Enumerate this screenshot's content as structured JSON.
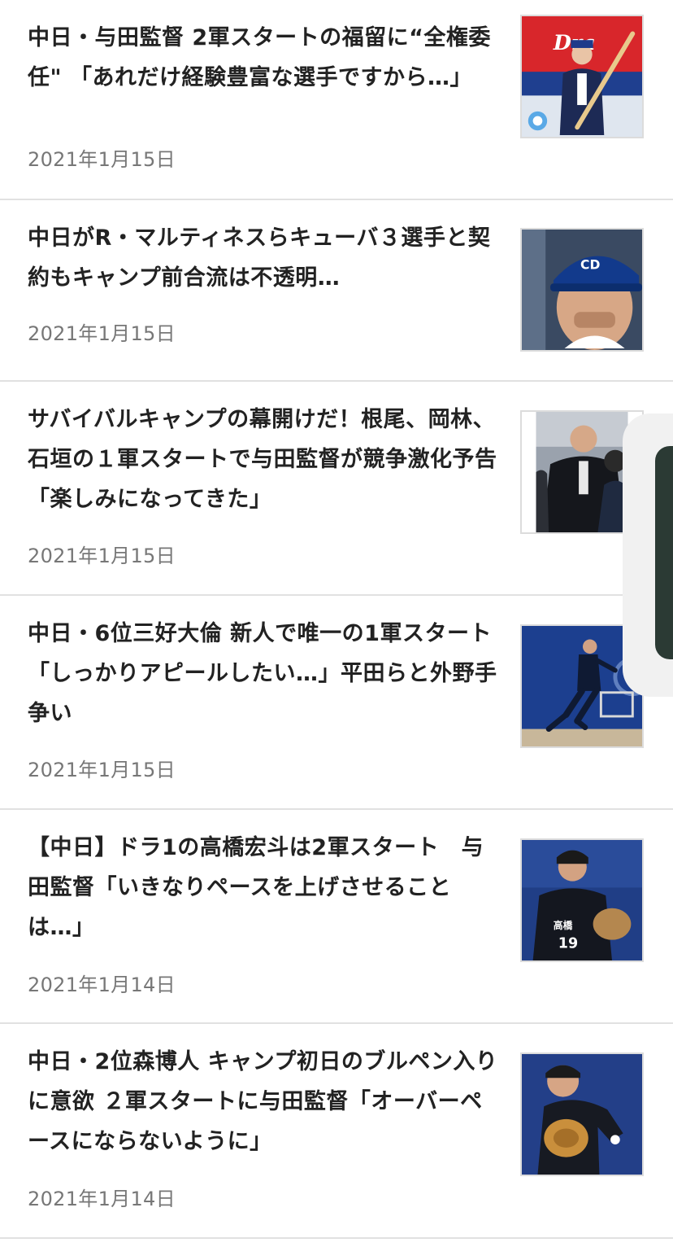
{
  "articles": [
    {
      "title": "中日・与田監督 2軍スタートの福留に“全権委任\" 「あれだけ経験豊富な選手ですから…」",
      "date": "2021年1月15日",
      "thumbnail": "manager-holding-bat-photo"
    },
    {
      "title": "中日がR・マルティネスらキューバ３選手と契約もキャンプ前合流は不透明…",
      "date": "2021年1月15日",
      "thumbnail": "player-in-cap-photo"
    },
    {
      "title": "サバイバルキャンプの幕開けだ！根尾、岡林、石垣の１軍スタートで与田監督が競争激化予告「楽しみになってきた」",
      "date": "2021年1月15日",
      "thumbnail": "manager-in-black-jacket-photo"
    },
    {
      "title": "中日・6位三好大倫 新人で唯一の1軍スタート 「しっかりアピールしたい…」平田らと外野手争い",
      "date": "2021年1月15日",
      "thumbnail": "player-running-photo"
    },
    {
      "title": "【中日】ドラ1の高橋宏斗は2軍スタート　与田監督「いきなりペースを上げさせることは…」",
      "date": "2021年1月14日",
      "thumbnail": "player-number-19-photo"
    },
    {
      "title": "中日・2位森博人 キャンプ初日のブルペン入りに意欲 ２軍スタートに与田監督「オーバーペースにならないように」",
      "date": "2021年1月14日",
      "thumbnail": "pitcher-with-glove-photo"
    }
  ],
  "colors": {
    "title": "#222222",
    "date": "#777777",
    "divider": "#e1e1e1"
  }
}
